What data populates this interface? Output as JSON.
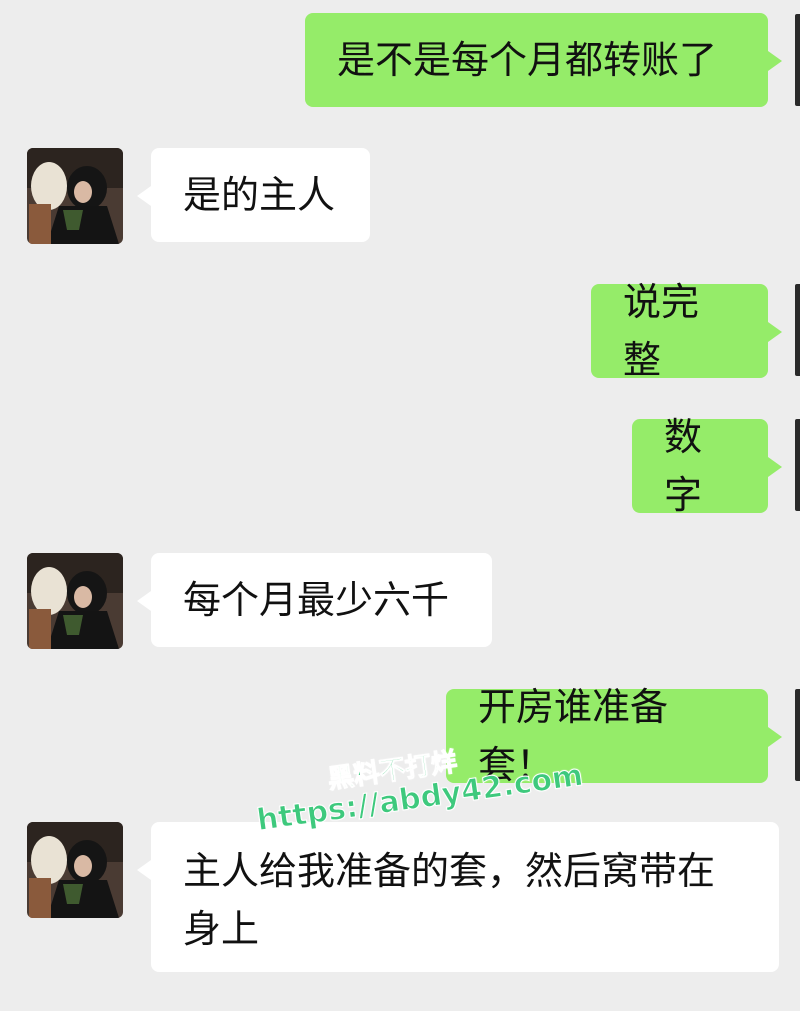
{
  "messages": [
    {
      "side": "out",
      "text": "是不是每个月都转账了"
    },
    {
      "side": "in",
      "text": "是的主人"
    },
    {
      "side": "out",
      "text": "说完整"
    },
    {
      "side": "out",
      "text": "数字"
    },
    {
      "side": "in",
      "text": "每个月最少六千"
    },
    {
      "side": "out",
      "text": "开房谁准备套！"
    },
    {
      "side": "in",
      "text": "主人给我准备的套，然后窝带在身上"
    }
  ],
  "watermark": {
    "line1": "黑料不打烊",
    "line2": "https://abdy42.com",
    "color": "#3ec97d"
  },
  "colors": {
    "background": "#ededed",
    "outgoing_bubble": "#95ec69",
    "incoming_bubble": "#ffffff"
  },
  "icons": {
    "contact_avatar": "avatar-photo-icon"
  }
}
